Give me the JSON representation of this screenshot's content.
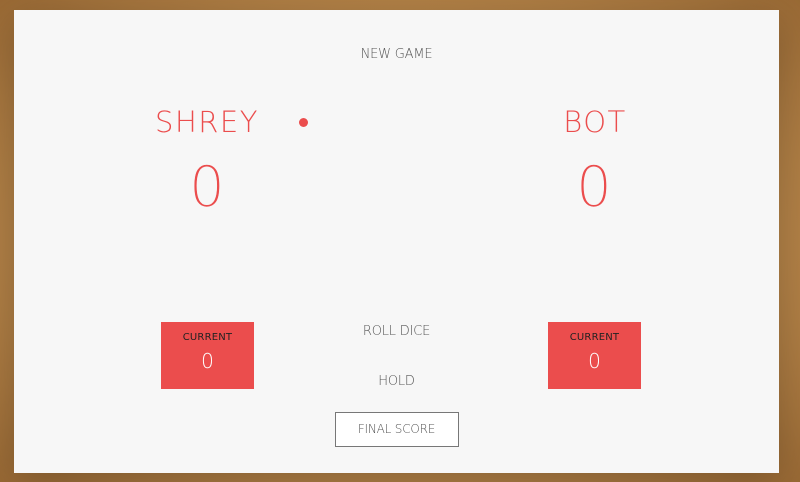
{
  "controls": {
    "new_game": "NEW GAME",
    "roll_dice": "ROLL DICE",
    "hold": "HOLD",
    "final_score": "FINAL SCORE"
  },
  "players": [
    {
      "name": "SHREY",
      "score": "0",
      "current_label": "CURRENT",
      "current_score": "0",
      "active": true
    },
    {
      "name": "BOT",
      "score": "0",
      "current_label": "CURRENT",
      "current_score": "0",
      "active": false
    }
  ],
  "colors": {
    "accent": "#eb4d4d",
    "panel_bg": "#f7f7f7",
    "text": "#555555"
  }
}
